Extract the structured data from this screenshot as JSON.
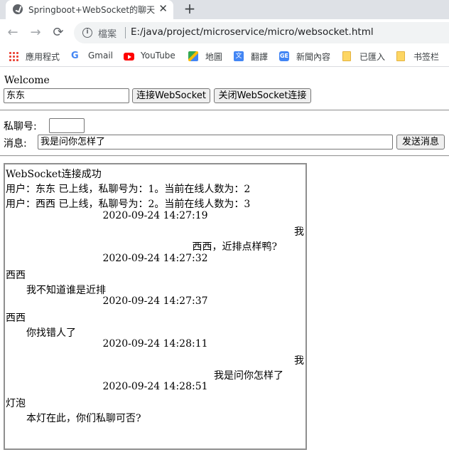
{
  "browser": {
    "tab_title": "Springboot+WebSocket的聊天",
    "tab_close": "✕",
    "new_tab": "+",
    "security_label": "檔案",
    "url": "E:/java/project/microservice/micro/websocket.html",
    "nav": {
      "back": "←",
      "forward": "→",
      "reload": "⟳"
    },
    "bookmarks": [
      {
        "label": "應用程式",
        "icon": "apps-grid-icon"
      },
      {
        "label": "Gmail",
        "icon": "google-g-icon"
      },
      {
        "label": "YouTube",
        "icon": "youtube-icon"
      },
      {
        "label": "地圖",
        "icon": "maps-icon"
      },
      {
        "label": "翻譯",
        "icon": "translate-icon"
      },
      {
        "label": "新聞內容",
        "icon": "news-icon"
      },
      {
        "label": "已匯入",
        "icon": "folder-icon"
      },
      {
        "label": "书签栏",
        "icon": "folder-icon"
      }
    ]
  },
  "page": {
    "welcome": "Welcome",
    "username_value": "东东",
    "connect_button": "连接WebSocket",
    "disconnect_button": "关闭WebSocket连接",
    "private_label": "私聊号:",
    "private_value": "",
    "message_label": "消息:",
    "message_value": "我是问你怎样了",
    "send_button": "发送消息"
  },
  "messages": {
    "system": [
      "WebSocket连接成功",
      "用户：东东 已上线，私聊号为：1。当前在线人数为：2",
      "用户：西西 已上线，私聊号为：2。当前在线人数为：3"
    ],
    "chat": [
      {
        "time": "2020-09-24 14:27:19",
        "sender": "我",
        "text": "西西，近排点样鸭?",
        "side": "right"
      },
      {
        "time": "2020-09-24 14:27:32",
        "sender": "西西",
        "text": "我不知道谁是近排",
        "side": "left"
      },
      {
        "time": "2020-09-24 14:27:37",
        "sender": "西西",
        "text": "你找错人了",
        "side": "left"
      },
      {
        "time": "2020-09-24 14:28:11",
        "sender": "我",
        "text": "我是问你怎样了",
        "side": "right"
      },
      {
        "time": "2020-09-24 14:28:51",
        "sender": "灯泡",
        "text": "本灯在此，你们私聊可否?",
        "side": "left"
      }
    ]
  }
}
